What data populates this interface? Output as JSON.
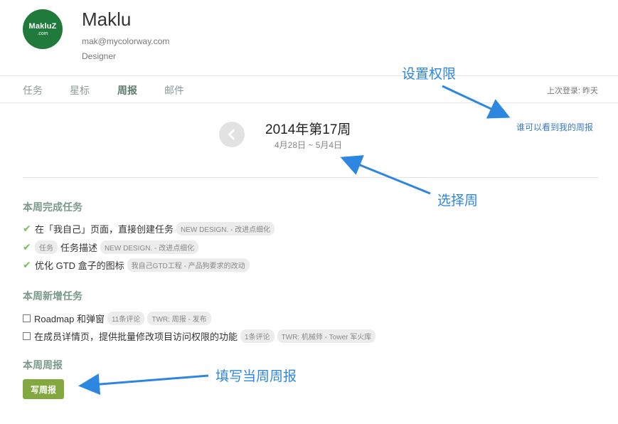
{
  "profile": {
    "avatar_brand": "MakluZ",
    "avatar_sub": ".com",
    "name": "Maklu",
    "email": "mak@mycolorway.com",
    "role": "Designer"
  },
  "nav": {
    "tabs": [
      {
        "label": "任务"
      },
      {
        "label": "星标"
      },
      {
        "label": "周报"
      },
      {
        "label": "邮件"
      }
    ],
    "active_tab": "周报",
    "last_login": "上次登录: 昨天"
  },
  "week": {
    "title": "2014年第17周",
    "range": "4月28日 ~ 5月4日",
    "permission_link": "谁可以看到我的周报"
  },
  "completed": {
    "title": "本周完成任务",
    "tasks": [
      {
        "label": "在「我自己」页面，直接创建任务",
        "prefix_tag": "",
        "tag": "NEW DESIGN. - 改进点细化"
      },
      {
        "label": "任务描述",
        "prefix_tag": "任务",
        "tag": "NEW DESIGN. - 改进点细化"
      },
      {
        "label": "优化 GTD 盒子的图标",
        "prefix_tag": "",
        "tag": "我自己GTD工程 - 产品狗要求的改动"
      }
    ]
  },
  "new_tasks": {
    "title": "本周新增任务",
    "tasks": [
      {
        "label": "Roadmap 和弹窗",
        "comments": "11条评论",
        "tag": "TWR: 周报 - 发布"
      },
      {
        "label": "在成员详情页，提供批量修改项目访问权限的功能",
        "comments": "1条评论",
        "tag": "TWR: 机械师 - Tower 军火库"
      }
    ]
  },
  "report": {
    "title": "本周周报",
    "write_button": "写周报"
  },
  "annotations": {
    "permission": "设置权限",
    "select_week": "选择周",
    "fill_report": "填写当周周报"
  },
  "colors": {
    "accent_link": "#3a7bc8",
    "annotation": "#2d87e0",
    "button_green": "#83a83f",
    "avatar_green": "#1f7a3c",
    "check_green": "#7cc05a"
  }
}
